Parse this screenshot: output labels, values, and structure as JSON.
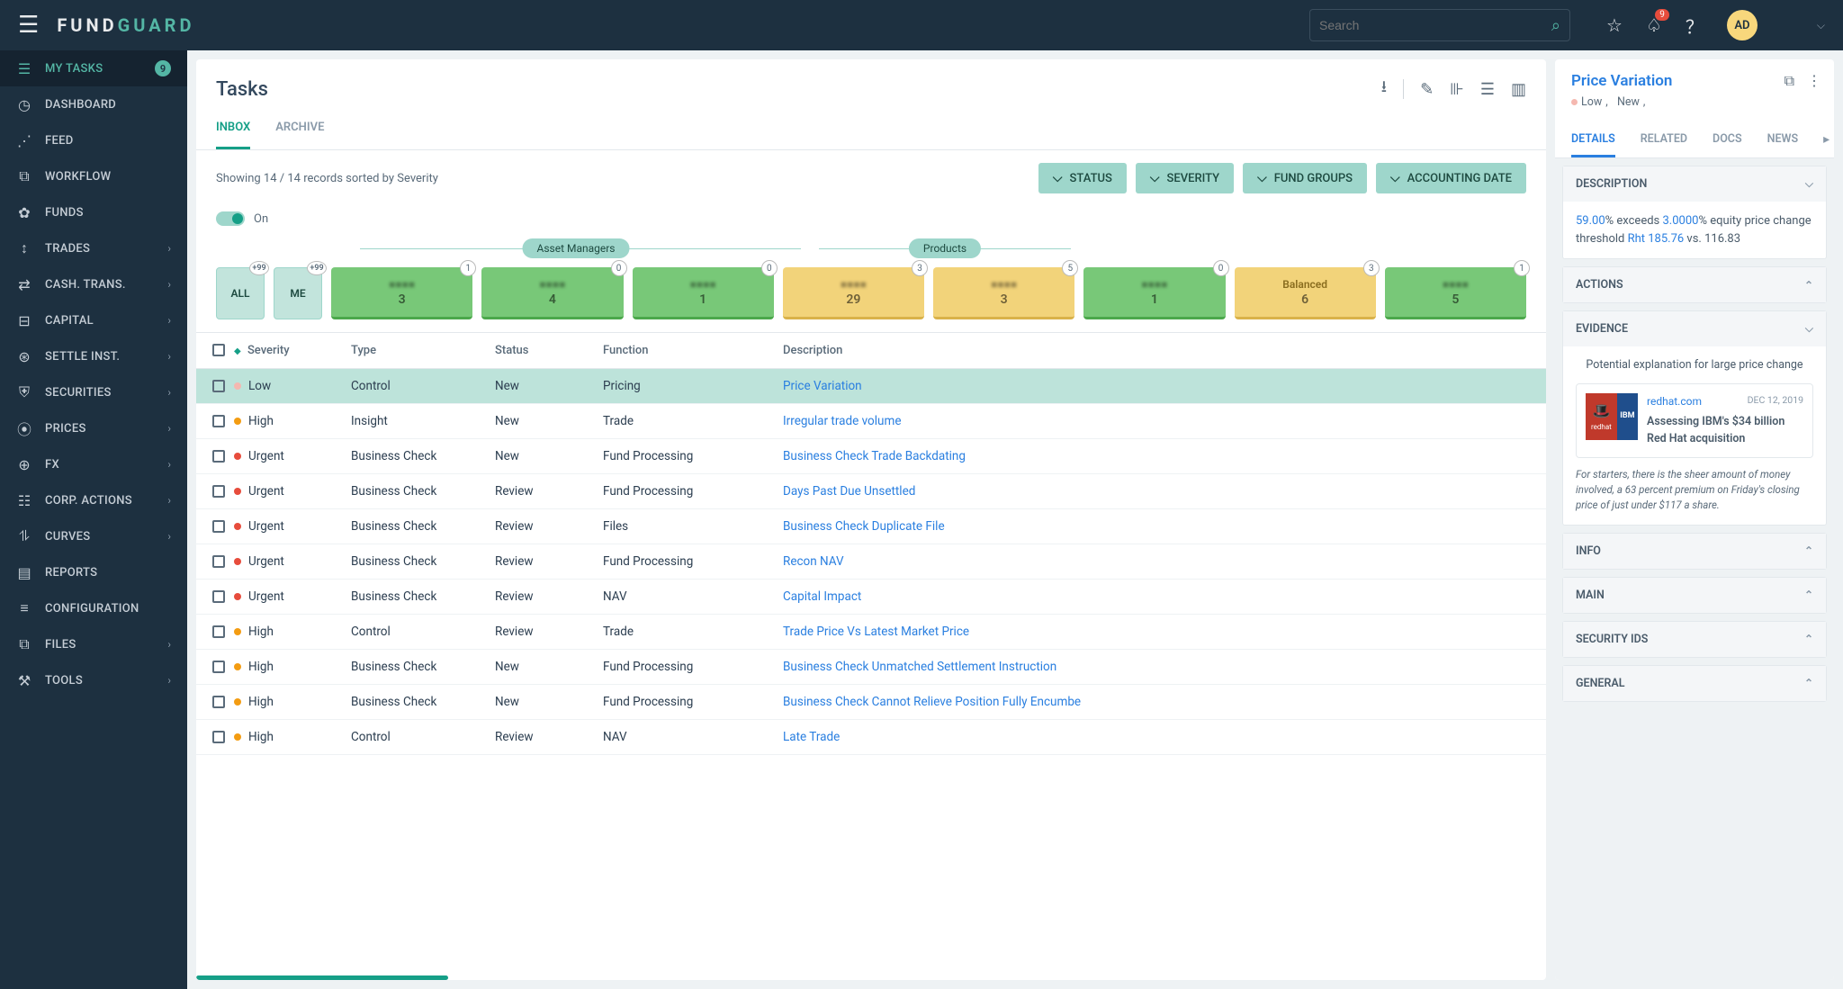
{
  "header": {
    "logo_left": "FUND",
    "logo_right": "GUARD",
    "search_placeholder": "Search",
    "notif_count": "9",
    "avatar": "AD"
  },
  "sidebar": {
    "items": [
      {
        "icon": "☰",
        "label": "MY TASKS",
        "count": "9",
        "active": true
      },
      {
        "icon": "◷",
        "label": "DASHBOARD"
      },
      {
        "icon": "⋰",
        "label": "FEED"
      },
      {
        "icon": "⧉",
        "label": "WORKFLOW"
      },
      {
        "icon": "✿",
        "label": "FUNDS"
      },
      {
        "icon": "↕",
        "label": "TRADES",
        "chev": true
      },
      {
        "icon": "⇄",
        "label": "CASH. TRANS.",
        "chev": true
      },
      {
        "icon": "⊟",
        "label": "CAPITAL",
        "chev": true
      },
      {
        "icon": "⊛",
        "label": "SETTLE INST.",
        "chev": true
      },
      {
        "icon": "⛨",
        "label": "SECURITIES",
        "chev": true
      },
      {
        "icon": "⦿",
        "label": "PRICES",
        "chev": true
      },
      {
        "icon": "⊕",
        "label": "FX",
        "chev": true
      },
      {
        "icon": "☷",
        "label": "CORP. ACTIONS",
        "chev": true
      },
      {
        "icon": "⥮",
        "label": "CURVES",
        "chev": true
      },
      {
        "icon": "▤",
        "label": "REPORTS"
      },
      {
        "icon": "≡",
        "label": "CONFIGURATION"
      },
      {
        "icon": "⧉",
        "label": "FILES",
        "chev": true
      },
      {
        "icon": "⚒",
        "label": "TOOLS",
        "chev": true
      }
    ]
  },
  "tasks": {
    "title": "Tasks",
    "tabs": [
      "INBOX",
      "ARCHIVE"
    ],
    "records_text": "Showing 14 / 14 records sorted by Severity",
    "filters": [
      "STATUS",
      "SEVERITY",
      "FUND GROUPS",
      "ACCOUNTING DATE"
    ],
    "toggle_label": "On",
    "lanes": {
      "group_labels": [
        "Asset Managers",
        "Products"
      ],
      "quick": [
        {
          "label": "ALL",
          "badge": "+99"
        },
        {
          "label": "ME",
          "badge": "+99"
        }
      ],
      "cards": [
        {
          "color": "green",
          "name": "",
          "num": "3",
          "cb": "1"
        },
        {
          "color": "green",
          "name": "",
          "num": "4",
          "cb": "0"
        },
        {
          "color": "green",
          "name": "",
          "num": "1",
          "cb": "0"
        },
        {
          "color": "yellow",
          "name": "",
          "num": "29",
          "cb": "3"
        },
        {
          "color": "yellow",
          "name": "",
          "num": "3",
          "cb": "5"
        },
        {
          "color": "green",
          "name": "",
          "num": "1",
          "cb": "0"
        },
        {
          "color": "yellow",
          "name": "Balanced",
          "num": "6",
          "cb": "3",
          "sharp": true
        },
        {
          "color": "green",
          "name": "",
          "num": "5",
          "cb": "1"
        }
      ]
    },
    "columns": [
      "Severity",
      "Type",
      "Status",
      "Function",
      "Description"
    ],
    "rows": [
      {
        "sev": "Low",
        "sevc": "low",
        "type": "Control",
        "status": "New",
        "func": "Pricing",
        "desc": "Price Variation",
        "selected": true
      },
      {
        "sev": "High",
        "sevc": "high",
        "type": "Insight",
        "status": "New",
        "func": "Trade",
        "desc": "Irregular trade volume"
      },
      {
        "sev": "Urgent",
        "sevc": "urgent",
        "type": "Business Check",
        "status": "New",
        "func": "Fund Processing",
        "desc": "Business Check Trade Backdating"
      },
      {
        "sev": "Urgent",
        "sevc": "urgent",
        "type": "Business Check",
        "status": "Review",
        "func": "Fund Processing",
        "desc": "Days Past Due Unsettled"
      },
      {
        "sev": "Urgent",
        "sevc": "urgent",
        "type": "Business Check",
        "status": "Review",
        "func": "Files",
        "desc": "Business Check Duplicate File"
      },
      {
        "sev": "Urgent",
        "sevc": "urgent",
        "type": "Business Check",
        "status": "Review",
        "func": "Fund Processing",
        "desc": "Recon NAV"
      },
      {
        "sev": "Urgent",
        "sevc": "urgent",
        "type": "Business Check",
        "status": "Review",
        "func": "NAV",
        "desc": "Capital Impact"
      },
      {
        "sev": "High",
        "sevc": "high",
        "type": "Control",
        "status": "Review",
        "func": "Trade",
        "desc": "Trade Price Vs Latest Market Price"
      },
      {
        "sev": "High",
        "sevc": "high",
        "type": "Business Check",
        "status": "New",
        "func": "Fund Processing",
        "desc": "Business Check Unmatched Settlement Instruction"
      },
      {
        "sev": "High",
        "sevc": "high",
        "type": "Business Check",
        "status": "New",
        "func": "Fund Processing",
        "desc": "Business Check Cannot Relieve Position Fully Encumbe"
      },
      {
        "sev": "High",
        "sevc": "high",
        "type": "Control",
        "status": "Review",
        "func": "NAV",
        "desc": "Late Trade"
      }
    ]
  },
  "detail": {
    "title": "Price Variation",
    "meta_sev": "Low",
    "meta_status": "New",
    "tabs": [
      "DETAILS",
      "RELATED",
      "DOCS",
      "NEWS"
    ],
    "sections": {
      "description": {
        "label": "DESCRIPTION",
        "v1": "59.00",
        "t1": "% exceeds ",
        "v2": "3.0000",
        "t2": "% equity price change threshold ",
        "v3": "Rht 185.76",
        "t3": " vs. 116.83"
      },
      "actions": {
        "label": "ACTIONS"
      },
      "evidence": {
        "label": "EVIDENCE",
        "subtitle": "Potential explanation for large price change",
        "redhat": "redhat",
        "ibm": "IBM",
        "source": "redhat.com",
        "date": "DEC 12, 2019",
        "headline": "Assessing IBM's $34 billion Red Hat acquisition",
        "text": "For starters, there is the sheer amount of money involved, a 63 percent premium on Friday's closing price of just under $117 a share."
      },
      "info": {
        "label": "INFO"
      },
      "main": {
        "label": "MAIN"
      },
      "security": {
        "label": "SECURITY IDS"
      },
      "general": {
        "label": "GENERAL"
      }
    }
  }
}
